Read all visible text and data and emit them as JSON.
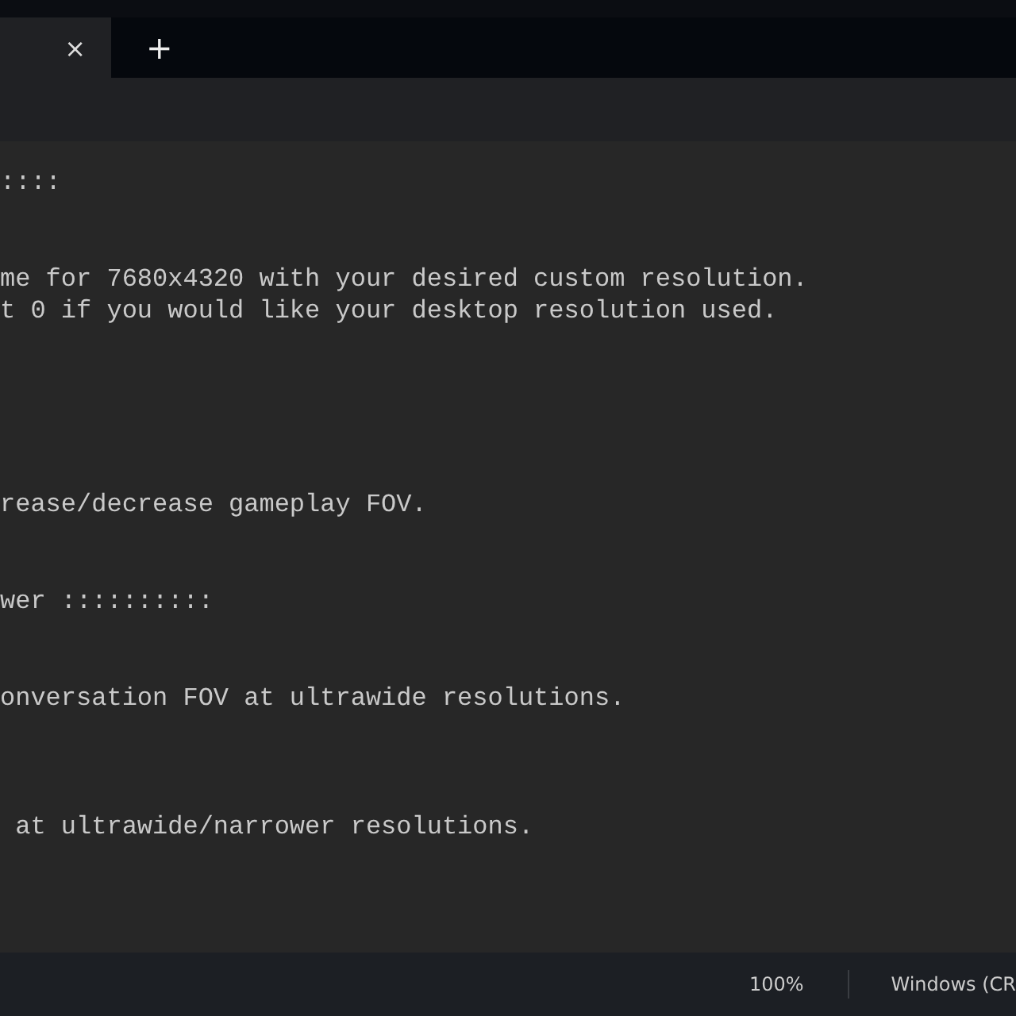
{
  "tabs": [
    {
      "close": "×",
      "selected": true
    }
  ],
  "new_tab": "+",
  "editor": {
    "text": "::::\n\n\nme for 7680x4320 with your desired custom resolution.\nt 0 if you would like your desktop resolution used.\n\n\n\n\n\nrease/decrease gameplay FOV.\n\n\nwer ::::::::::\n\n\nonversation FOV at ultrawide resolutions.\n\n\n\n at ultrawide/narrower resolutions."
  },
  "status_bar": {
    "zoom": "100%",
    "line_ending": "Windows (CR"
  }
}
